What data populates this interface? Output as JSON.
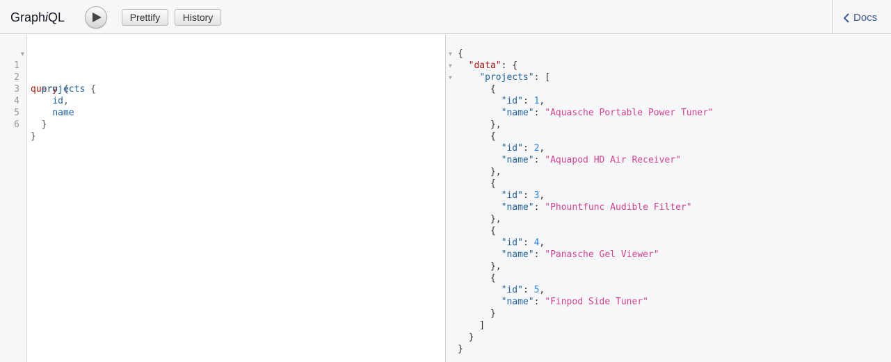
{
  "topbar": {
    "title_prefix": "Graph",
    "title_italic": "i",
    "title_suffix": "QL",
    "prettify_label": "Prettify",
    "history_label": "History",
    "docs_label": "Docs"
  },
  "editor": {
    "lines": [
      {
        "num": "1",
        "fold": true
      },
      {
        "num": "2",
        "fold": false
      },
      {
        "num": "3",
        "fold": false
      },
      {
        "num": "4",
        "fold": false
      },
      {
        "num": "5",
        "fold": false
      },
      {
        "num": "6",
        "fold": false
      }
    ],
    "query_keyword": "query",
    "open_brace": "{",
    "close_brace": "}",
    "root_field": "projects",
    "field_id": "id",
    "field_name": "name",
    "comma": ","
  },
  "result": {
    "data_key": "\"data\"",
    "projects_key": "\"projects\"",
    "id_key": "\"id\"",
    "name_key": "\"name\"",
    "projects": [
      {
        "id": "1",
        "name": "\"Aquasche Portable Power Tuner\""
      },
      {
        "id": "2",
        "name": "\"Aquapod HD Air Receiver\""
      },
      {
        "id": "3",
        "name": "\"Phountfunc Audible Filter\""
      },
      {
        "id": "4",
        "name": "\"Panasche Gel Viewer\""
      },
      {
        "id": "5",
        "name": "\"Finpod Side Tuner\""
      }
    ]
  },
  "icons": {
    "run": "play-icon",
    "docs": "chevron-left-icon",
    "fold": "fold-arrow-icon"
  }
}
